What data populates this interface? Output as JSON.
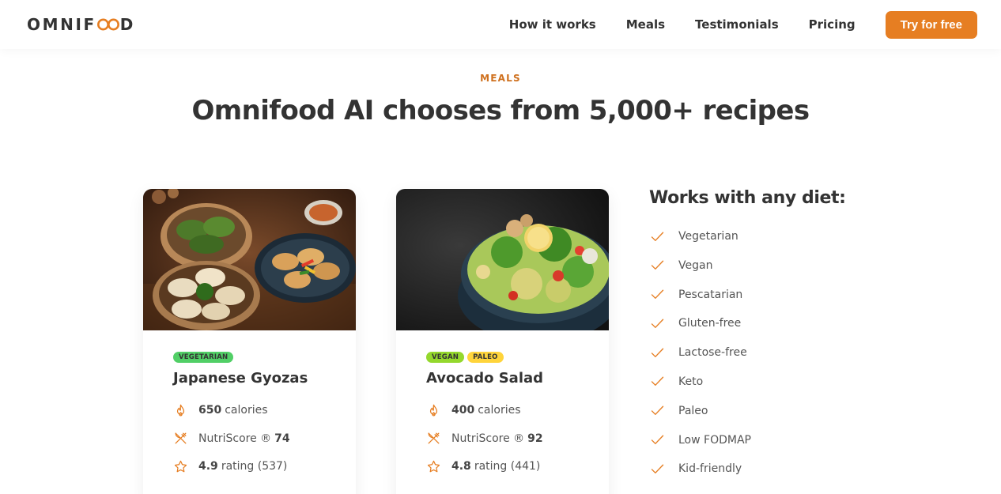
{
  "header": {
    "logo_left": "OMNIF",
    "logo_right": "D",
    "nav": [
      "How it works",
      "Meals",
      "Testimonials",
      "Pricing"
    ],
    "cta_label": "Try for free"
  },
  "section": {
    "subheading": "MEALS",
    "heading": "Omnifood AI chooses from 5,000+ recipes"
  },
  "meals": [
    {
      "tags": [
        "VEGETARIAN"
      ],
      "title": "Japanese Gyozas",
      "calories_value": "650",
      "calories_label": "calories",
      "nutri_label": "NutriScore ®",
      "nutri_value": "74",
      "rating_value": "4.9",
      "rating_label": "rating (537)"
    },
    {
      "tags": [
        "VEGAN",
        "PALEO"
      ],
      "title": "Avocado Salad",
      "calories_value": "400",
      "calories_label": "calories",
      "nutri_label": "NutriScore ®",
      "nutri_value": "92",
      "rating_value": "4.8",
      "rating_label": "rating (441)"
    }
  ],
  "diets": {
    "title": "Works with any diet:",
    "items": [
      "Vegetarian",
      "Vegan",
      "Pescatarian",
      "Gluten-free",
      "Lactose-free",
      "Keto",
      "Paleo",
      "Low FODMAP",
      "Kid-friendly"
    ]
  },
  "colors": {
    "accent": "#e67e22",
    "accent_dark": "#cf711f",
    "tag_vegetarian": "#51cf66",
    "tag_vegan": "#94d82d",
    "tag_paleo": "#ffd43b"
  },
  "icons": {
    "calories": "flame-icon",
    "nutri": "utensils-icon",
    "rating": "star-icon",
    "diet": "checkmark-icon"
  }
}
